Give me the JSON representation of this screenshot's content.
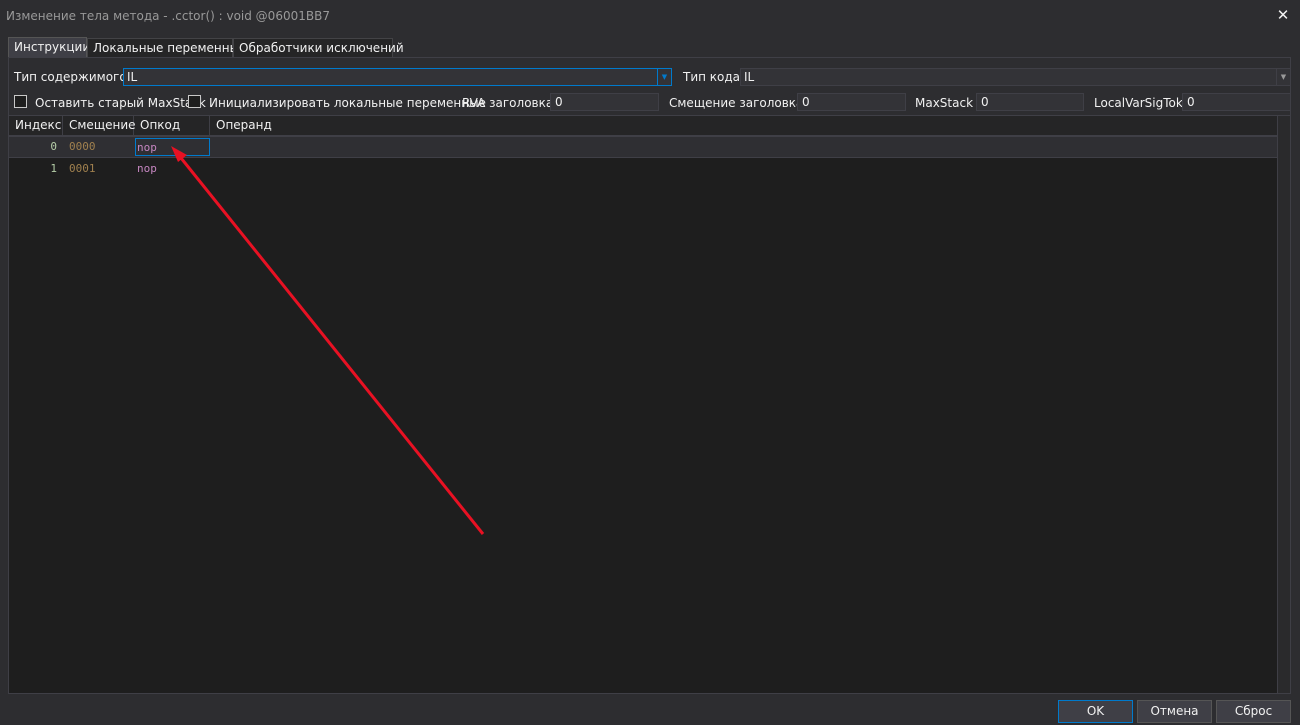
{
  "window": {
    "title": "Изменение тела метода - .cctor() : void @06001BB7",
    "close_glyph": "✕"
  },
  "tabs": [
    "Инструкции",
    "Локальные переменные",
    "Обработчики исключений"
  ],
  "form": {
    "content_type_label": "Тип содержимого",
    "content_type_value": "IL",
    "code_type_label": "Тип кода",
    "code_type_value": "IL",
    "keep_old_maxstack_label": "Оставить старый MaxStack",
    "keep_old_maxstack_checked": false,
    "init_locals_label": "Инициализировать локальные переменные",
    "init_locals_checked": false,
    "rva_label": "RVA заголовка",
    "rva_value": "0",
    "header_offset_label": "Смещение заголовка",
    "header_offset_value": "0",
    "maxstack_label": "MaxStack",
    "maxstack_value": "0",
    "localvarsigtok_label": "LocalVarSigTok",
    "localvarsigtok_value": "0"
  },
  "grid": {
    "columns": [
      "Индекс",
      "Смещение",
      "Опкод",
      "Операнд"
    ],
    "rows": [
      {
        "index": "0",
        "offset": "0000",
        "opcode": "nop",
        "operand": ""
      },
      {
        "index": "1",
        "offset": "0001",
        "opcode": "nop",
        "operand": ""
      }
    ]
  },
  "buttons": {
    "ok": "OK",
    "cancel": "Отмена",
    "reset": "Сброс"
  },
  "annotation": {
    "arrow_color": "#e81123"
  },
  "colors": {
    "background": "#2d2d30",
    "grid_background": "#1e1e1e",
    "accent": "#007acc",
    "opcode": "#c586c0",
    "offset": "#a0804e",
    "index": "#b5cea8"
  }
}
